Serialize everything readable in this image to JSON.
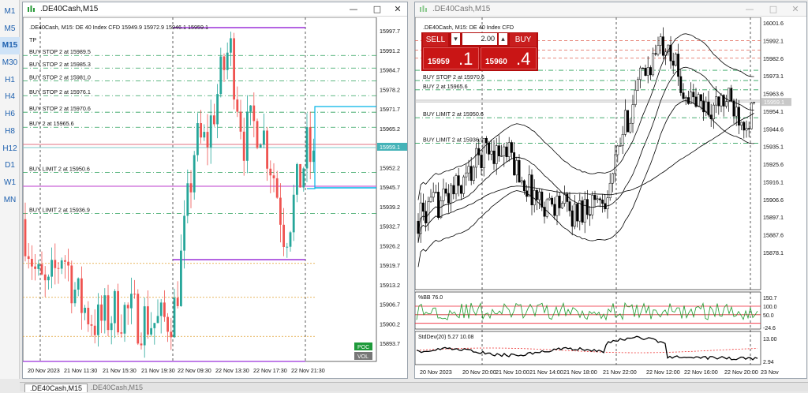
{
  "sidebar": {
    "timeframes": [
      "M1",
      "M5",
      "M15",
      "M30",
      "H1",
      "H4",
      "H6",
      "H8",
      "H12",
      "D1",
      "W1",
      "MN"
    ],
    "active": "M15"
  },
  "window1": {
    "title": ".DE40Cash,M15",
    "info": ".DE40Cash, M15:  DE 40 Index CFD   15949.9 15972.9 15946.1 15959.1",
    "tp_label": "TP",
    "orders": [
      {
        "label": "BUY STOP 2 at 15989.5",
        "price": 15989.5
      },
      {
        "label": "BUY STOP 2 at 15985.3",
        "price": 15985.3
      },
      {
        "label": "BUY STOP 2 at 15981.0",
        "price": 15981.0
      },
      {
        "label": "BUY STOP 2 at 15976.1",
        "price": 15976.1
      },
      {
        "label": "BUY STOP 2 at 15970.6",
        "price": 15970.6
      },
      {
        "label": "BUY 2 at 15965.6",
        "price": 15965.6
      },
      {
        "label": "BUY LIMIT 2 at 15950.6",
        "price": 15950.6
      },
      {
        "label": "BUY LIMIT 2 at 15936.9",
        "price": 15936.9
      }
    ],
    "price_axis": [
      "15997.7",
      "15991.2",
      "15984.7",
      "15978.2",
      "15971.7",
      "15965.2",
      "15958.7",
      "15952.2",
      "15945.7",
      "15939.2",
      "15932.7",
      "15926.2",
      "15919.7",
      "15913.2",
      "15906.7",
      "15900.2",
      "15893.7"
    ],
    "current_price": "15959.1",
    "time_axis": [
      "20 Nov 2023",
      "21 Nov 11:30",
      "21 Nov 15:30",
      "21 Nov 19:30",
      "22 Nov 09:30",
      "22 Nov 13:30",
      "22 Nov 17:30",
      "22 Nov 21:30"
    ],
    "poc_label": "POC",
    "vol_label": "VOL",
    "colors": {
      "bull": "#26a69a",
      "bear": "#ef5350",
      "level_purple": "#9b30d9",
      "level_cyan": "#00b4e6"
    }
  },
  "window2": {
    "title": ".DE40Cash,M15",
    "info": ".DE40Cash, M15:  DE 40 Index CFD",
    "trade_panel": {
      "sell_label": "SELL",
      "buy_label": "BUY",
      "volume": "2.00",
      "bid_small": "15959",
      "bid_big": ".1",
      "ask_small": "15960",
      "ask_big": ".4"
    },
    "orders": [
      {
        "label": "BUY STOP 2 at 15976.1",
        "price": 15976.1
      },
      {
        "label": "BUY STOP 2 at 15970.6",
        "price": 15970.6
      },
      {
        "label": "BUY 2 at 15965.6",
        "price": 15965.6
      },
      {
        "label": "BUY LIMIT 2 at 15950.6",
        "price": 15950.6
      },
      {
        "label": "BUY LIMIT 2 at 15936.9",
        "price": 15936.9
      }
    ],
    "price_axis": [
      "16001.6",
      "15992.1",
      "15982.6",
      "15973.1",
      "15963.6",
      "15954.1",
      "15944.6",
      "15935.1",
      "15925.6",
      "15916.1",
      "15906.6",
      "15897.1",
      "15887.6",
      "15878.1"
    ],
    "current_price": "15959.1",
    "bb_label": "%BB 76.0",
    "bb_axis": [
      "150.7",
      "100.0",
      "50.0",
      "-24.6"
    ],
    "std_label": "StdDev(20) 5.27 10.08",
    "std_axis": [
      "13.00",
      "2.94"
    ],
    "time_axis": [
      "20 Nov 2023",
      "20 Nov 20:00",
      "21 Nov 10:00",
      "21 Nov 14:00",
      "21 Nov 18:00",
      "21 Nov 22:00",
      "22 Nov 12:00",
      "22 Nov 16:00",
      "22 Nov 20:00",
      "23 Nov"
    ]
  },
  "tabs": [
    {
      "label": ".DE40Cash,M15",
      "active": true
    },
    {
      "label": ".DE40Cash,M15",
      "active": false
    }
  ]
}
